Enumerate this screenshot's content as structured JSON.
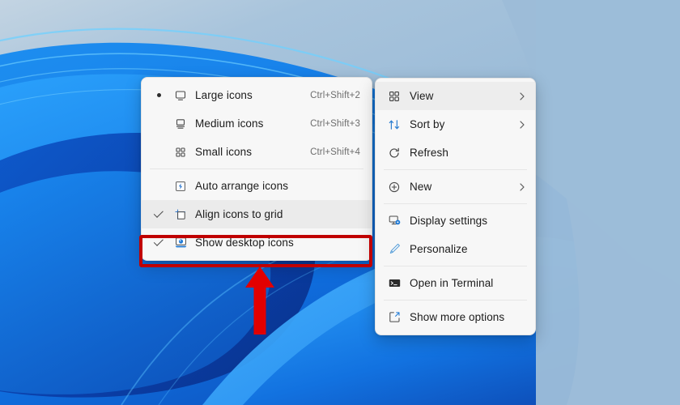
{
  "desktop": {
    "wallpaper_name": "windows-11-bloom-wallpaper",
    "background_color": "#9cbcd8",
    "accent_blue": "#0c6ed1",
    "deep_blue": "#0a3faa"
  },
  "view_submenu": {
    "name": "View submenu",
    "items": [
      {
        "label": "Large icons",
        "accel": "Ctrl+Shift+2",
        "mark": "bullet",
        "icon": "large-icons-icon"
      },
      {
        "label": "Medium icons",
        "accel": "Ctrl+Shift+3",
        "mark": "none",
        "icon": "medium-icons-icon"
      },
      {
        "label": "Small icons",
        "accel": "Ctrl+Shift+4",
        "mark": "none",
        "icon": "small-icons-icon"
      },
      {
        "label": "Auto arrange icons",
        "accel": "",
        "mark": "none",
        "icon": "auto-arrange-icon"
      },
      {
        "label": "Align icons to grid",
        "accel": "",
        "mark": "check",
        "icon": "align-grid-icon"
      },
      {
        "label": "Show desktop icons",
        "accel": "",
        "mark": "check",
        "icon": "show-desktop-icons-icon"
      }
    ]
  },
  "context_menu": {
    "name": "Desktop context menu",
    "items": [
      {
        "label": "View",
        "icon": "view-grid-icon",
        "submenu": true
      },
      {
        "label": "Sort by",
        "icon": "sort-arrows-icon",
        "submenu": true
      },
      {
        "label": "Refresh",
        "icon": "refresh-icon",
        "submenu": false
      },
      {
        "label": "New",
        "icon": "new-plus-icon",
        "submenu": true
      },
      {
        "label": "Display settings",
        "icon": "display-settings-icon",
        "submenu": false
      },
      {
        "label": "Personalize",
        "icon": "personalize-brush-icon",
        "submenu": false
      },
      {
        "label": "Open in Terminal",
        "icon": "terminal-icon",
        "submenu": false
      },
      {
        "label": "Show more options",
        "icon": "show-more-options-icon",
        "submenu": false
      }
    ]
  },
  "annotation": {
    "highlight_target": "Show desktop icons",
    "highlight_color": "#c00000",
    "arrow_color": "#e00000",
    "arrow_direction": "up"
  }
}
